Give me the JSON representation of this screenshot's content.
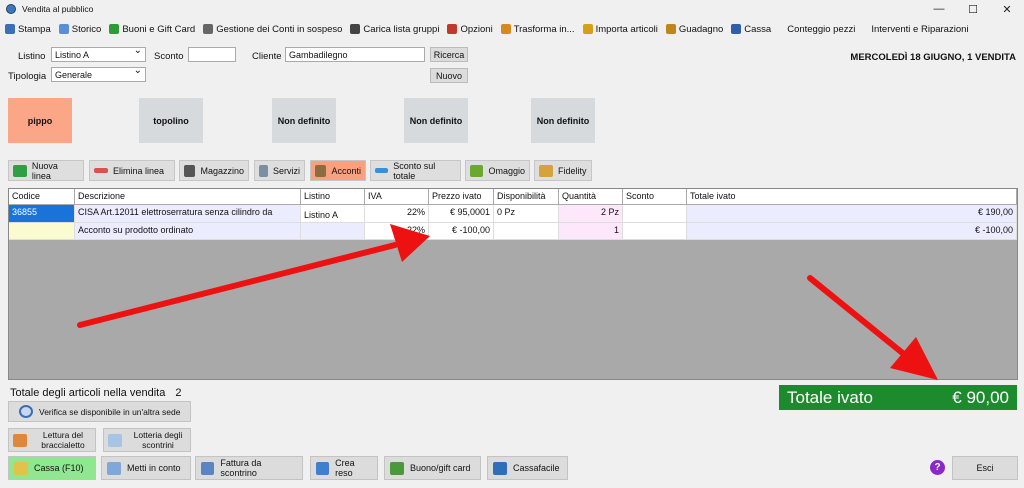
{
  "window": {
    "title": "Vendita al pubblico"
  },
  "menu": [
    {
      "label": "Stampa",
      "icon": "printer-icon",
      "color": "#3b6fb6"
    },
    {
      "label": "Storico",
      "icon": "document-icon",
      "color": "#5a8fd6"
    },
    {
      "label": "Buoni e Gift Card",
      "icon": "gift-icon",
      "color": "#2e9b3a"
    },
    {
      "label": "Gestione dei Conti in sospeso",
      "icon": "ledger-icon",
      "color": "#666666"
    },
    {
      "label": "Carica lista gruppi",
      "icon": "list-icon",
      "color": "#444444"
    },
    {
      "label": "Opzioni",
      "icon": "tools-icon",
      "color": "#c0392b"
    },
    {
      "label": "Trasforma in...",
      "icon": "transform-icon",
      "color": "#d68a1e"
    },
    {
      "label": "Importa articoli",
      "icon": "import-icon",
      "color": "#d4a017"
    },
    {
      "label": "Guadagno",
      "icon": "money-bag-icon",
      "color": "#c0861e"
    },
    {
      "label": "Cassa",
      "icon": "cash-register-icon",
      "color": "#2f5fa8"
    },
    {
      "label": "Conteggio pezzi",
      "icon": "",
      "color": ""
    },
    {
      "label": "Interventi e Riparazioni",
      "icon": "",
      "color": ""
    }
  ],
  "form": {
    "listino_label": "Listino",
    "listino_value": "Listino A",
    "sconto_label": "Sconto",
    "sconto_value": "",
    "cliente_label": "Cliente",
    "cliente_value": "Gambadilegno",
    "tipologia_label": "Tipologia",
    "tipologia_value": "Generale",
    "ricerca_label": "Ricerca",
    "nuovo_label": "Nuovo",
    "date": "MERCOLEDÌ 18 GIUGNO, 1 VENDITA"
  },
  "tiles": [
    "pippo",
    "topolino",
    "Non definito",
    "Non definito",
    "Non definito"
  ],
  "toolbar": [
    {
      "label": "Nuova linea",
      "icon": "plus-icon",
      "color": "#2ea043"
    },
    {
      "label": "Elimina linea",
      "icon": "minus-icon",
      "color": "#d9534f"
    },
    {
      "label": "Magazzino",
      "icon": "forklift-icon",
      "color": "#555555"
    },
    {
      "label": "Servizi",
      "icon": "services-icon",
      "color": "#7a8fa6"
    },
    {
      "label": "Acconti",
      "icon": "deposit-icon",
      "color": "#8c6d3f"
    },
    {
      "label": "Sconto sul totale",
      "icon": "discount-icon",
      "color": "#3a8fd6"
    },
    {
      "label": "Omaggio",
      "icon": "gift-box-icon",
      "color": "#6ba832"
    },
    {
      "label": "Fidelity",
      "icon": "fidelity-card-icon",
      "color": "#d6a23a"
    }
  ],
  "grid": {
    "columns": [
      "Codice",
      "Descrizione",
      "Listino",
      "IVA",
      "Prezzo ivato",
      "Disponibilità",
      "Quantità",
      "Sconto",
      "Totale ivato"
    ],
    "rows": [
      {
        "codice": "36855",
        "descrizione": "CISA Art.12011 elettroserratura senza cilindro da",
        "listino": "Listino A",
        "iva": "22%",
        "prezzo": "€ 95,0001",
        "disp": "0 Pz",
        "qta": "2 Pz",
        "sconto": "",
        "totale": "€ 190,00"
      },
      {
        "codice": "",
        "descrizione": "Acconto su prodotto ordinato",
        "listino": "",
        "iva": "22%",
        "prezzo": "€ -100,00",
        "disp": "",
        "qta": "1",
        "sconto": "",
        "totale": "€ -100,00"
      }
    ]
  },
  "summary": {
    "label": "Totale degli articoli nella vendita",
    "count": "2"
  },
  "total": {
    "label": "Totale ivato",
    "value": "€ 90,00"
  },
  "side_buttons": {
    "verifica": "Verifica se disponibile in un'altra sede",
    "lettura": "Lettura del braccialetto",
    "lotteria": "Lotteria degli scontrini"
  },
  "bottom_buttons": [
    {
      "label": "Cassa (F10)",
      "icon": "cash-icon"
    },
    {
      "label": "Metti in conto",
      "icon": "book-icon"
    },
    {
      "label": "Fattura da scontrino",
      "icon": "invoice-icon"
    },
    {
      "label": "Crea reso",
      "icon": "return-arrow-icon"
    },
    {
      "label": "Buono/gift card",
      "icon": "voucher-icon"
    },
    {
      "label": "Cassafacile",
      "icon": "monitor-icon"
    }
  ],
  "esci_label": "Esci",
  "help_glyph": "?"
}
